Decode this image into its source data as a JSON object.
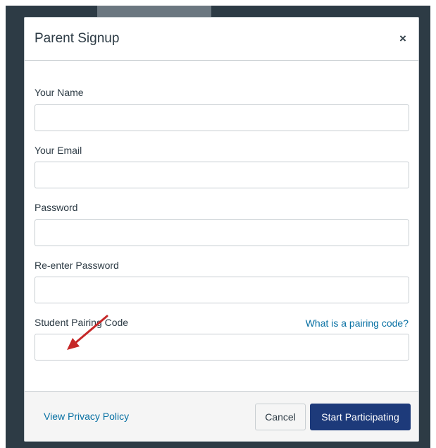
{
  "dialog": {
    "title": "Parent Signup",
    "close_glyph": "×"
  },
  "form": {
    "name_label": "Your Name",
    "name_value": "",
    "email_label": "Your Email",
    "email_value": "",
    "password_label": "Password",
    "password_value": "",
    "confirm_password_label": "Re-enter Password",
    "confirm_password_value": "",
    "pairing_code_label": "Student Pairing Code",
    "pairing_code_value": "",
    "pairing_code_help": "What is a pairing code?"
  },
  "footer": {
    "privacy_label": "View Privacy Policy",
    "cancel_label": "Cancel",
    "submit_label": "Start Participating"
  },
  "colors": {
    "backdrop": "#2d3b45",
    "primary_button": "#1d3a7a",
    "link": "#0770a3",
    "annotation_arrow": "#c62828"
  },
  "icons": {
    "close": "close-icon",
    "annotation": "arrow-annotation-icon"
  }
}
